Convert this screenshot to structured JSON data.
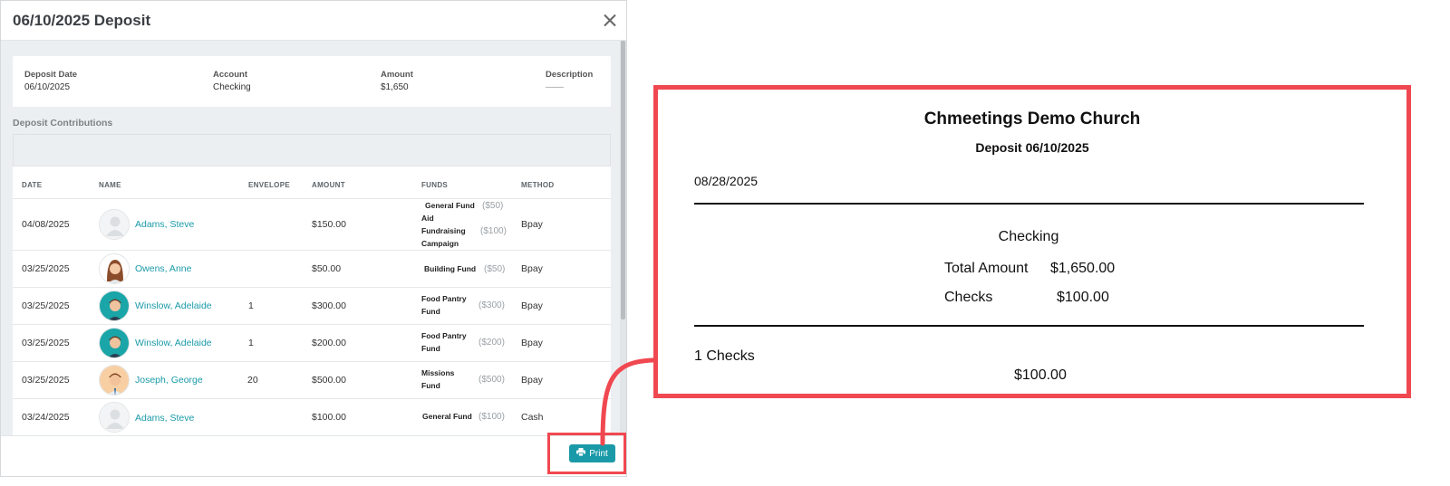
{
  "modal": {
    "title": "06/10/2025 Deposit",
    "summary": {
      "deposit_date_label": "Deposit Date",
      "deposit_date_value": "06/10/2025",
      "account_label": "Account",
      "account_value": "Checking",
      "amount_label": "Amount",
      "amount_value": "$1,650",
      "description_label": "Description",
      "description_value": "——"
    },
    "section_title": "Deposit Contributions",
    "columns": [
      "DATE",
      "NAME",
      "ENVELOPE",
      "AMOUNT",
      "FUNDS",
      "METHOD"
    ],
    "rows": [
      {
        "date": "04/08/2025",
        "name": "Adams, Steve",
        "avatar": "default-avatar",
        "envelope": "",
        "amount": "$150.00",
        "funds": [
          {
            "name_lines": [
              "General Fund"
            ],
            "amount": "($50)"
          },
          {
            "name_lines": [
              "Aid",
              "Fundraising",
              "Campaign"
            ],
            "amount": "($100)"
          }
        ],
        "method": "Bpay"
      },
      {
        "date": "03/25/2025",
        "name": "Owens, Anne",
        "avatar": "woman-avatar",
        "envelope": "",
        "amount": "$50.00",
        "funds": [
          {
            "name_lines": [
              "Building Fund"
            ],
            "amount": "($50)"
          }
        ],
        "method": "Bpay"
      },
      {
        "date": "03/25/2025",
        "name": "Winslow, Adelaide",
        "avatar": "man-teal-avatar",
        "envelope": "1",
        "amount": "$300.00",
        "funds": [
          {
            "name_lines": [
              "Food Pantry",
              "Fund"
            ],
            "amount": "($300)"
          }
        ],
        "method": "Bpay"
      },
      {
        "date": "03/25/2025",
        "name": "Winslow, Adelaide",
        "avatar": "man-teal-avatar",
        "envelope": "1",
        "amount": "$200.00",
        "funds": [
          {
            "name_lines": [
              "Food Pantry",
              "Fund"
            ],
            "amount": "($200)"
          }
        ],
        "method": "Bpay"
      },
      {
        "date": "03/25/2025",
        "name": "Joseph, George",
        "avatar": "man-peach-avatar",
        "envelope": "20",
        "amount": "$500.00",
        "funds": [
          {
            "name_lines": [
              "Missions",
              "Fund"
            ],
            "amount": "($500)"
          }
        ],
        "method": "Bpay"
      },
      {
        "date": "03/24/2025",
        "name": "Adams, Steve",
        "avatar": "default-avatar",
        "envelope": "",
        "amount": "$100.00",
        "funds": [
          {
            "name_lines": [
              "General Fund"
            ],
            "amount": "($100)"
          }
        ],
        "method": "Cash"
      }
    ],
    "print_label": "Print",
    "icons": {
      "close": "close-icon",
      "print": "printer-icon"
    }
  },
  "preview": {
    "church": "Chmeetings Demo Church",
    "title": "Deposit 06/10/2025",
    "date": "08/28/2025",
    "account": "Checking",
    "total_label": "Total Amount",
    "total_value": "$1,650.00",
    "checks_label": "Checks",
    "checks_value": "$100.00",
    "checks_count": "1 Checks",
    "checks_total": "$100.00"
  },
  "colors": {
    "accent": "#1a9aa8",
    "highlight": "#f04850"
  }
}
